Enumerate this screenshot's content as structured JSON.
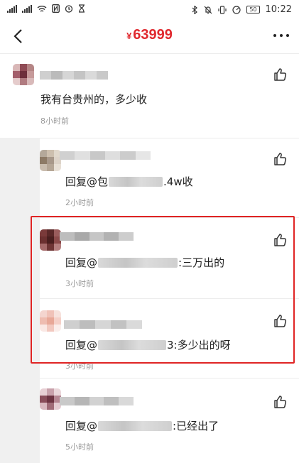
{
  "statusbar": {
    "battery": "50",
    "time": "10:22"
  },
  "header": {
    "currency": "¥",
    "price": "63999"
  },
  "comments": [
    {
      "text": "我有台贵州的，多少收",
      "time": "8小时前"
    },
    {
      "prefix": "回复@",
      "suffix_a": "包",
      "suffix_b": ".4w收",
      "time": "2小时前"
    },
    {
      "prefix": "回复@",
      "suffix": ":三万出的",
      "time": "3小时前"
    },
    {
      "prefix": "回复@",
      "suffix": "3:多少出的呀",
      "time": "3小时前"
    },
    {
      "prefix": "回复@",
      "suffix": ":已经出了",
      "time": "5小时前"
    }
  ],
  "colors": {
    "price": "#e0282e",
    "highlight": "#e02424"
  }
}
